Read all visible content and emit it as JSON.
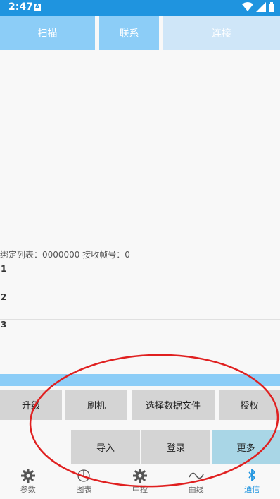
{
  "status": {
    "time": "2:47",
    "badge": "A"
  },
  "top_buttons": {
    "scan": "扫描",
    "contact": "联系",
    "connect": "连接"
  },
  "binding": {
    "text": "绑定列表：0000000  接收帧号：0"
  },
  "slots": [
    "1",
    "2",
    "3"
  ],
  "actions": {
    "upgrade": "升级",
    "flash": "刷机",
    "select_file": "选择数据文件",
    "authorize": "授权",
    "import": "导入",
    "login": "登录",
    "more": "更多"
  },
  "nav": {
    "params": "参数",
    "charts": "图表",
    "control": "中控",
    "curve": "曲线",
    "comm": "通信"
  },
  "colors": {
    "accent": "#1f94df",
    "button_light_blue": "#8ccdf7",
    "annotation": "#e02020"
  }
}
